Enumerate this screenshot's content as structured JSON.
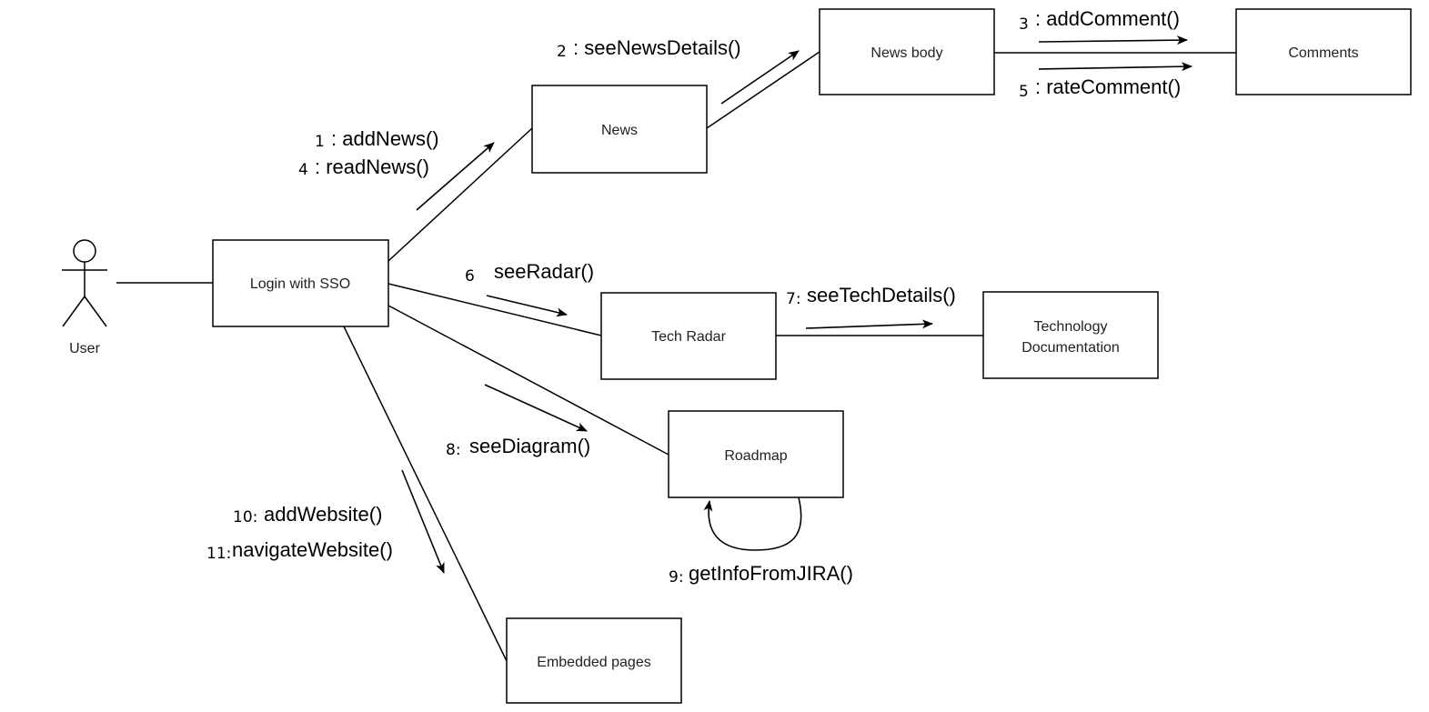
{
  "colors": {
    "stroke": "#000000",
    "background": "#ffffff",
    "box_text": "#222222"
  },
  "actor": {
    "label": "User"
  },
  "objects": {
    "login": "Login with SSO",
    "news": "News",
    "news_body": "News body",
    "comments": "Comments",
    "tech_radar": "Tech Radar",
    "tech_doc_line1": "Technology",
    "tech_doc_line2": "Documentation",
    "roadmap": "Roadmap",
    "embedded": "Embedded pages"
  },
  "messages": {
    "m1": {
      "num": "1",
      "label": ": addNews()"
    },
    "m4": {
      "num": "4",
      "label": ": readNews()"
    },
    "m2": {
      "num": "2",
      "label": ": seeNewsDetails()"
    },
    "m3": {
      "num": "3",
      "label": ": addComment()"
    },
    "m5": {
      "num": "5",
      "label": ": rateComment()"
    },
    "m6": {
      "num": "6",
      "label": "seeRadar()"
    },
    "m7": {
      "num": "7:",
      "label": "seeTechDetails()"
    },
    "m8": {
      "num": "8:",
      "label": "seeDiagram()"
    },
    "m9": {
      "num": "9:",
      "label": "getInfoFromJIRA()"
    },
    "m10": {
      "num": "10:",
      "label": "addWebsite()"
    },
    "m11": {
      "num": "11:",
      "label": "navigateWebsite()"
    }
  }
}
